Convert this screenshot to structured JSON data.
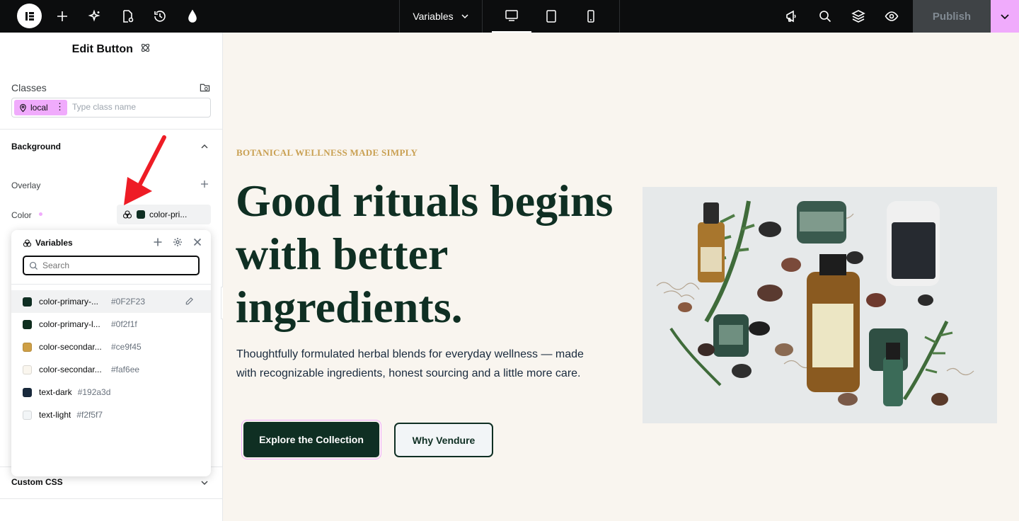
{
  "topbar": {
    "variables_label": "Variables",
    "publish_label": "Publish",
    "colors": {
      "bar": "#0c0d0e",
      "publish_dropdown": "#f0abfc"
    }
  },
  "panel": {
    "title": "Edit Button",
    "classes_label": "Classes",
    "class_chip": "local",
    "class_input_placeholder": "Type class name",
    "background_section": "Background",
    "overlay_label": "Overlay",
    "color_label": "Color",
    "color_value": "color-pri...",
    "custom_css_section": "Custom CSS"
  },
  "variables_popover": {
    "title": "Variables",
    "search_placeholder": "Search",
    "items": [
      {
        "name": "color-primary-...",
        "value": "#0F2F23",
        "swatch": "#0f2f23"
      },
      {
        "name": "color-primary-l...",
        "value": "#0f2f1f",
        "swatch": "#0f2f1f"
      },
      {
        "name": "color-secondar...",
        "value": "#ce9f45",
        "swatch": "#ce9f45"
      },
      {
        "name": "color-secondar...",
        "value": "#faf6ee",
        "swatch": "#faf6ee"
      },
      {
        "name": "text-dark",
        "value": "#192a3d",
        "swatch": "#192a3d"
      },
      {
        "name": "text-light",
        "value": "#f2f5f7",
        "swatch": "#f2f5f7"
      }
    ]
  },
  "canvas": {
    "eyebrow": "BOTANICAL WELLNESS MADE SIMPLY",
    "hero_title": "Good rituals begins with better ingredients.",
    "hero_subtitle": "Thoughtfully formulated herbal blends for everyday wellness — made with recognizable ingredients, honest sourcing and a little more care.",
    "primary_button": "Explore the Collection",
    "secondary_button": "Why Vendure",
    "colors": {
      "background": "#f9f5ef",
      "accent": "#c9a052",
      "primary": "#0f2f23"
    }
  }
}
